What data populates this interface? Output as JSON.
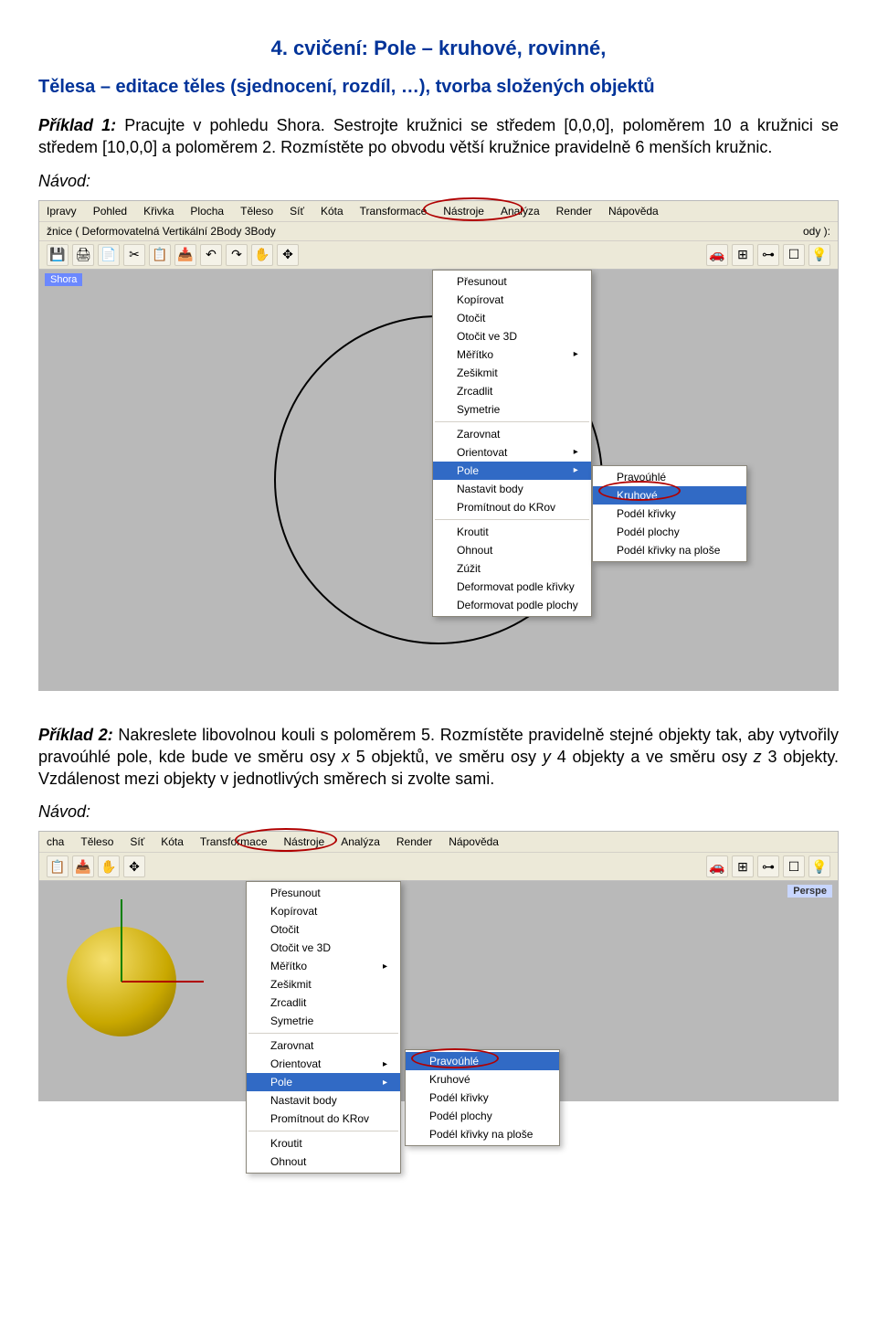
{
  "title": "4. cvičení: Pole – kruhové, rovinné,",
  "subtitle": "Tělesa – editace těles (sjednocení, rozdíl, …), tvorba složených objektů",
  "p1a": "Příklad 1:",
  "p1b": " Pracujte v pohledu Shora. Sestrojte kružnici se středem [0,0,0], poloměrem 10 a kružnici se středem [10,0,0] a poloměrem 2. Rozmístěte po obvodu větší kružnice pravidelně 6 menších kružnic.",
  "navod": "Návod:",
  "p2a": "Příklad 2:",
  "p2b_head": " Nakreslete libovolnou kouli s poloměrem 5. Rozmístěte pravidelně stejné objekty tak, aby vytvořily pravoúhlé pole, kde bude ve směru osy ",
  "p2b_x": "x",
  "p2b_mid1": " 5 objektů, ve směru osy ",
  "p2b_y": "y",
  "p2b_mid2": " 4 objekty a ve směru osy ",
  "p2b_z": "z",
  "p2b_tail": " 3 objekty. Vzdálenost mezi objekty v jednotlivých směrech si zvolte sami.",
  "shot1": {
    "menubar": [
      "Ipravy",
      "Pohled",
      "Křivka",
      "Plocha",
      "Těleso",
      "Síť",
      "Kóta",
      "Transformace",
      "Nástroje",
      "Analýza",
      "Render",
      "Nápověda"
    ],
    "input_row": "žnice ( Deformovatelná  Vertikální  2Body  3Body",
    "input_tail": "ody ):",
    "vp_label": "Shora",
    "dd1": {
      "items_top": [
        "Přesunout",
        "Kopírovat",
        "Otočit",
        "Otočit ve 3D",
        "Měřítko",
        "Zešikmit",
        "Zrcadlit",
        "Symetrie"
      ],
      "items_mid": [
        "Zarovnat",
        "Orientovat",
        "Pole",
        "Nastavit body",
        "Promítnout do KRov"
      ],
      "items_bot": [
        "Kroutit",
        "Ohnout",
        "Zúžit",
        "Deformovat podle křivky",
        "Deformovat podle plochy"
      ],
      "arrows": [
        "Měřítko",
        "Orientovat",
        "Pole"
      ],
      "highlight": "Pole"
    },
    "dd2": {
      "items": [
        "Pravoúhlé",
        "Kruhové",
        "Podél křivky",
        "Podél plochy",
        "Podél křivky na ploše"
      ],
      "highlight": "Kruhové"
    }
  },
  "shot2": {
    "menubar": [
      "cha",
      "Těleso",
      "Síť",
      "Kóta",
      "Transformace",
      "Nástroje",
      "Analýza",
      "Render",
      "Nápověda"
    ],
    "vp_label": "Perspe",
    "dd1": {
      "items_top": [
        "Přesunout",
        "Kopírovat",
        "Otočit",
        "Otočit ve 3D",
        "Měřítko",
        "Zešikmit",
        "Zrcadlit",
        "Symetrie"
      ],
      "items_mid": [
        "Zarovnat",
        "Orientovat",
        "Pole",
        "Nastavit body",
        "Promítnout do KRov"
      ],
      "items_bot": [
        "Kroutit",
        "Ohnout"
      ],
      "arrows": [
        "Měřítko",
        "Orientovat",
        "Pole"
      ],
      "highlight": "Pole"
    },
    "dd2": {
      "items": [
        "Pravoúhlé",
        "Kruhové",
        "Podél křivky",
        "Podél plochy",
        "Podél křivky na ploše"
      ],
      "highlight": "Pravoúhlé"
    }
  },
  "icons1": [
    "save",
    "print",
    "props",
    "cut",
    "copy",
    "paste",
    "undo",
    "redo",
    "pan",
    "rotate-view",
    "car",
    "axes",
    "link",
    "layers",
    "bulb"
  ],
  "icons2": [
    "copy",
    "paste",
    "pan",
    "rotate-view",
    "car",
    "axes",
    "link",
    "layers",
    "bulb"
  ]
}
